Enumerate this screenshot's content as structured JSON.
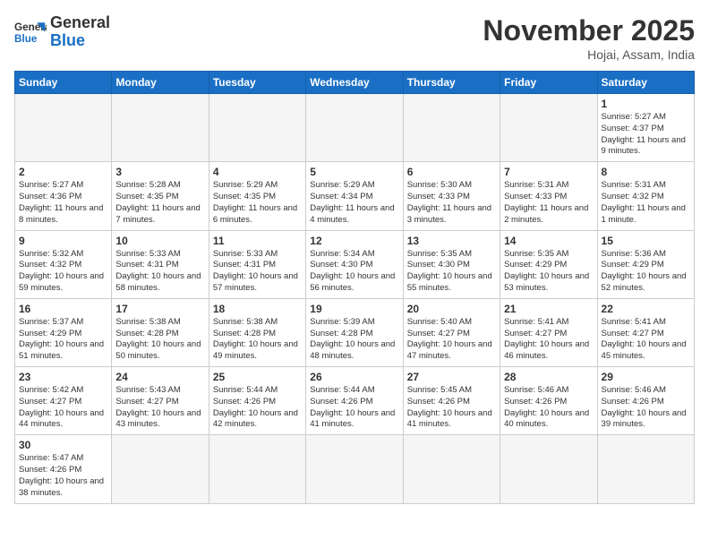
{
  "header": {
    "logo_general": "General",
    "logo_blue": "Blue",
    "month_title": "November 2025",
    "subtitle": "Hojai, Assam, India"
  },
  "days_of_week": [
    "Sunday",
    "Monday",
    "Tuesday",
    "Wednesday",
    "Thursday",
    "Friday",
    "Saturday"
  ],
  "weeks": [
    [
      {
        "day": "",
        "info": "",
        "empty": true
      },
      {
        "day": "",
        "info": "",
        "empty": true
      },
      {
        "day": "",
        "info": "",
        "empty": true
      },
      {
        "day": "",
        "info": "",
        "empty": true
      },
      {
        "day": "",
        "info": "",
        "empty": true
      },
      {
        "day": "",
        "info": "",
        "empty": true
      },
      {
        "day": "1",
        "info": "Sunrise: 5:27 AM\nSunset: 4:37 PM\nDaylight: 11 hours and 9 minutes."
      }
    ],
    [
      {
        "day": "2",
        "info": "Sunrise: 5:27 AM\nSunset: 4:36 PM\nDaylight: 11 hours and 8 minutes."
      },
      {
        "day": "3",
        "info": "Sunrise: 5:28 AM\nSunset: 4:35 PM\nDaylight: 11 hours and 7 minutes."
      },
      {
        "day": "4",
        "info": "Sunrise: 5:29 AM\nSunset: 4:35 PM\nDaylight: 11 hours and 6 minutes."
      },
      {
        "day": "5",
        "info": "Sunrise: 5:29 AM\nSunset: 4:34 PM\nDaylight: 11 hours and 4 minutes."
      },
      {
        "day": "6",
        "info": "Sunrise: 5:30 AM\nSunset: 4:33 PM\nDaylight: 11 hours and 3 minutes."
      },
      {
        "day": "7",
        "info": "Sunrise: 5:31 AM\nSunset: 4:33 PM\nDaylight: 11 hours and 2 minutes."
      },
      {
        "day": "8",
        "info": "Sunrise: 5:31 AM\nSunset: 4:32 PM\nDaylight: 11 hours and 1 minute."
      }
    ],
    [
      {
        "day": "9",
        "info": "Sunrise: 5:32 AM\nSunset: 4:32 PM\nDaylight: 10 hours and 59 minutes."
      },
      {
        "day": "10",
        "info": "Sunrise: 5:33 AM\nSunset: 4:31 PM\nDaylight: 10 hours and 58 minutes."
      },
      {
        "day": "11",
        "info": "Sunrise: 5:33 AM\nSunset: 4:31 PM\nDaylight: 10 hours and 57 minutes."
      },
      {
        "day": "12",
        "info": "Sunrise: 5:34 AM\nSunset: 4:30 PM\nDaylight: 10 hours and 56 minutes."
      },
      {
        "day": "13",
        "info": "Sunrise: 5:35 AM\nSunset: 4:30 PM\nDaylight: 10 hours and 55 minutes."
      },
      {
        "day": "14",
        "info": "Sunrise: 5:35 AM\nSunset: 4:29 PM\nDaylight: 10 hours and 53 minutes."
      },
      {
        "day": "15",
        "info": "Sunrise: 5:36 AM\nSunset: 4:29 PM\nDaylight: 10 hours and 52 minutes."
      }
    ],
    [
      {
        "day": "16",
        "info": "Sunrise: 5:37 AM\nSunset: 4:29 PM\nDaylight: 10 hours and 51 minutes."
      },
      {
        "day": "17",
        "info": "Sunrise: 5:38 AM\nSunset: 4:28 PM\nDaylight: 10 hours and 50 minutes."
      },
      {
        "day": "18",
        "info": "Sunrise: 5:38 AM\nSunset: 4:28 PM\nDaylight: 10 hours and 49 minutes."
      },
      {
        "day": "19",
        "info": "Sunrise: 5:39 AM\nSunset: 4:28 PM\nDaylight: 10 hours and 48 minutes."
      },
      {
        "day": "20",
        "info": "Sunrise: 5:40 AM\nSunset: 4:27 PM\nDaylight: 10 hours and 47 minutes."
      },
      {
        "day": "21",
        "info": "Sunrise: 5:41 AM\nSunset: 4:27 PM\nDaylight: 10 hours and 46 minutes."
      },
      {
        "day": "22",
        "info": "Sunrise: 5:41 AM\nSunset: 4:27 PM\nDaylight: 10 hours and 45 minutes."
      }
    ],
    [
      {
        "day": "23",
        "info": "Sunrise: 5:42 AM\nSunset: 4:27 PM\nDaylight: 10 hours and 44 minutes."
      },
      {
        "day": "24",
        "info": "Sunrise: 5:43 AM\nSunset: 4:27 PM\nDaylight: 10 hours and 43 minutes."
      },
      {
        "day": "25",
        "info": "Sunrise: 5:44 AM\nSunset: 4:26 PM\nDaylight: 10 hours and 42 minutes."
      },
      {
        "day": "26",
        "info": "Sunrise: 5:44 AM\nSunset: 4:26 PM\nDaylight: 10 hours and 41 minutes."
      },
      {
        "day": "27",
        "info": "Sunrise: 5:45 AM\nSunset: 4:26 PM\nDaylight: 10 hours and 41 minutes."
      },
      {
        "day": "28",
        "info": "Sunrise: 5:46 AM\nSunset: 4:26 PM\nDaylight: 10 hours and 40 minutes."
      },
      {
        "day": "29",
        "info": "Sunrise: 5:46 AM\nSunset: 4:26 PM\nDaylight: 10 hours and 39 minutes."
      }
    ],
    [
      {
        "day": "30",
        "info": "Sunrise: 5:47 AM\nSunset: 4:26 PM\nDaylight: 10 hours and 38 minutes."
      },
      {
        "day": "",
        "info": "",
        "empty": true
      },
      {
        "day": "",
        "info": "",
        "empty": true
      },
      {
        "day": "",
        "info": "",
        "empty": true
      },
      {
        "day": "",
        "info": "",
        "empty": true
      },
      {
        "day": "",
        "info": "",
        "empty": true
      },
      {
        "day": "",
        "info": "",
        "empty": true
      }
    ]
  ]
}
